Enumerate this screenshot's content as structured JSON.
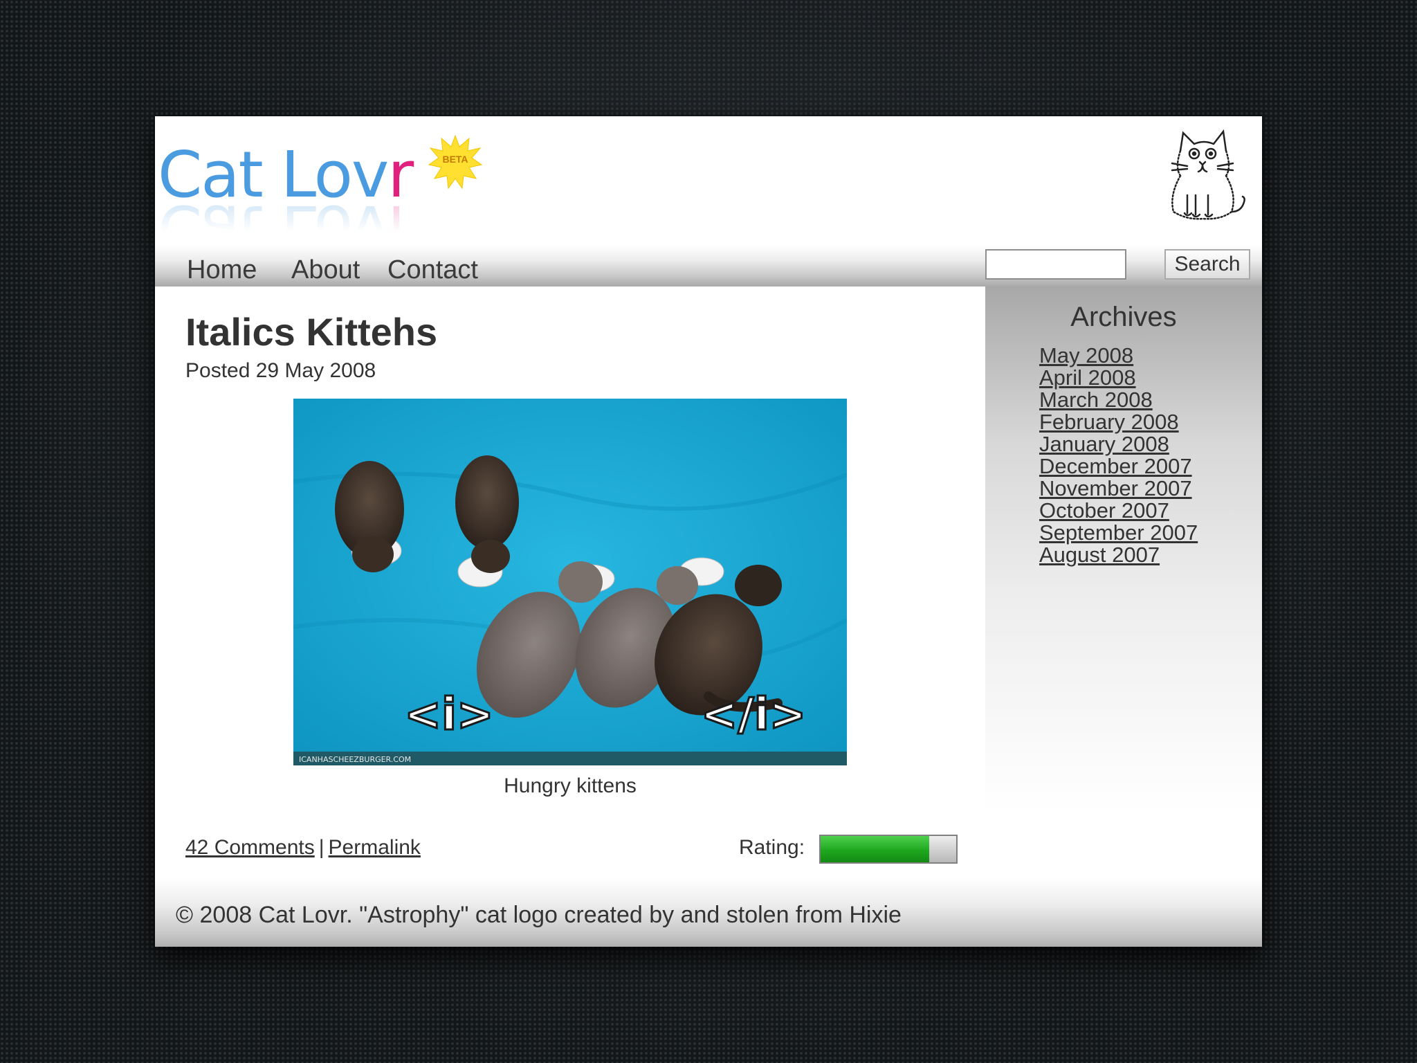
{
  "site": {
    "logo_text_main": "Cat Lov",
    "logo_text_accent": "r",
    "beta_badge": "BETA"
  },
  "nav": {
    "items": [
      {
        "label": "Home"
      },
      {
        "label": "About"
      },
      {
        "label": "Contact"
      }
    ],
    "search_value": "",
    "search_button": "Search"
  },
  "post": {
    "title": "Italics Kittehs",
    "date": "Posted 29 May 2008",
    "image_overlay_open": "<i>",
    "image_overlay_close": "</i>",
    "image_watermark": "ICANHASCHEEZBURGER.COM",
    "caption": "Hungry kittens",
    "comments_link": "42 Comments",
    "separator": "|",
    "permalink": "Permalink",
    "rating_label": "Rating:",
    "rating_fraction": 0.8
  },
  "sidebar": {
    "title": "Archives",
    "items": [
      "May 2008",
      "April 2008",
      "March 2008",
      "February 2008",
      "January 2008",
      "December 2007",
      "November 2007",
      "October 2007",
      "September 2007",
      "August 2007"
    ]
  },
  "footer": {
    "text": "© 2008 Cat Lovr. \"Astrophy\" cat logo created by and stolen from Hixie"
  },
  "colors": {
    "logo_blue": "#4b9be0",
    "logo_pink": "#e2207e",
    "rating_green": "#1fa81f",
    "image_background": "#19a9d2"
  }
}
